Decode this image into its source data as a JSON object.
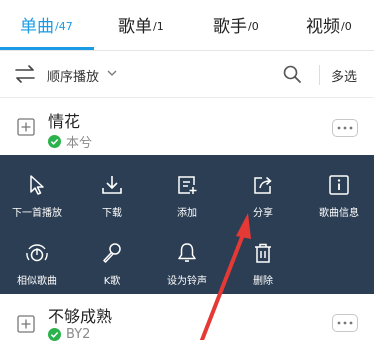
{
  "tabs": [
    {
      "label": "单曲",
      "count": "/47",
      "active": true
    },
    {
      "label": "歌单",
      "count": "/1",
      "active": false
    },
    {
      "label": "歌手",
      "count": "/0",
      "active": false
    },
    {
      "label": "视频",
      "count": "/0",
      "active": false
    }
  ],
  "toolbar": {
    "sort_label": "顺序播放",
    "multi_select_label": "多选",
    "icons": [
      "sort-icon",
      "chevron-down-icon",
      "search-icon"
    ]
  },
  "songs": [
    {
      "title": "情花",
      "artist": "本兮",
      "status": "downloaded"
    },
    {
      "title": "不够成熟",
      "artist": "BY2",
      "status": "downloaded"
    }
  ],
  "actions": [
    {
      "label": "下一首播放",
      "icon": "play-next-icon"
    },
    {
      "label": "下载",
      "icon": "download-icon"
    },
    {
      "label": "添加",
      "icon": "add-to-playlist-icon"
    },
    {
      "label": "分享",
      "icon": "share-icon"
    },
    {
      "label": "歌曲信息",
      "icon": "info-icon"
    },
    {
      "label": "相似歌曲",
      "icon": "similar-songs-icon"
    },
    {
      "label": "K歌",
      "icon": "microphone-icon"
    },
    {
      "label": "设为铃声",
      "icon": "bell-icon"
    },
    {
      "label": "删除",
      "icon": "trash-icon"
    }
  ],
  "colors": {
    "accent": "#1a9be6",
    "panel_bg": "#2c3e53",
    "check_green": "#2bb24c",
    "arrow_red": "#e53935"
  }
}
